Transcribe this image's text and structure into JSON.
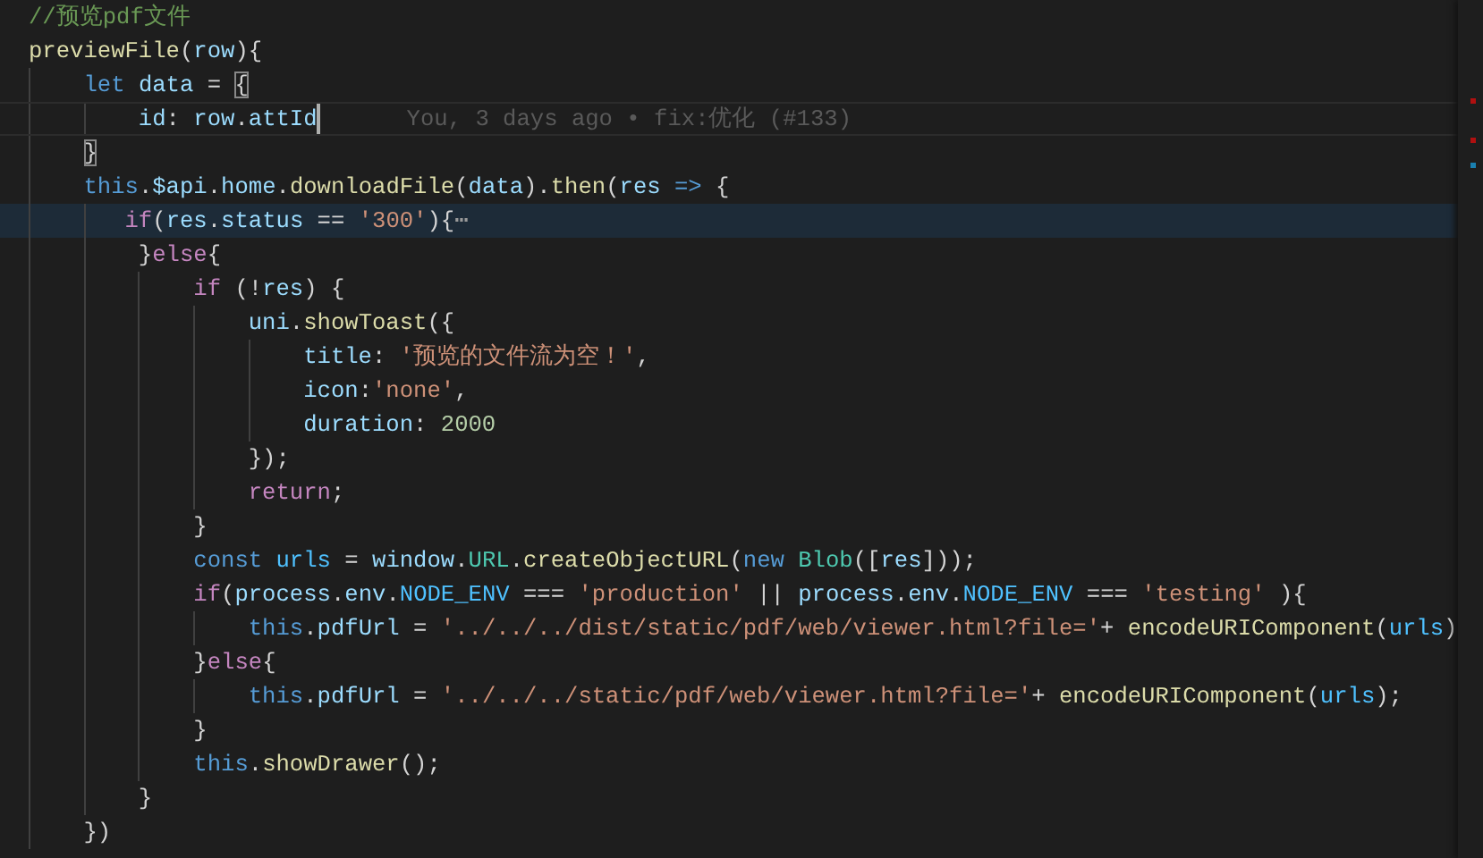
{
  "lines": [
    {
      "tokens": [
        {
          "text": "//预览pdf文件",
          "kind": "comment"
        }
      ]
    },
    {
      "tokens": [
        {
          "text": "previewFile",
          "kind": "function"
        },
        {
          "text": "(",
          "kind": "punct"
        },
        {
          "text": "row",
          "kind": "variable"
        },
        {
          "text": "){",
          "kind": "punct"
        }
      ]
    },
    {
      "tokens": [
        {
          "text": "    let",
          "kind": "keyword"
        },
        {
          "text": " data",
          "kind": "variable"
        },
        {
          "text": " = ",
          "kind": "punct"
        },
        {
          "text": "{",
          "kind": "bracket"
        }
      ]
    },
    {
      "current": true,
      "blame": "You, 3 days ago • fix:优化 (#133)",
      "tokens": [
        {
          "text": "        id",
          "kind": "variable"
        },
        {
          "text": ": ",
          "kind": "punct"
        },
        {
          "text": "row",
          "kind": "variable"
        },
        {
          "text": ".",
          "kind": "punct"
        },
        {
          "text": "attId",
          "kind": "variable"
        }
      ]
    },
    {
      "tokens": [
        {
          "text": "    }",
          "kind": "bracket"
        }
      ]
    },
    {
      "tokens": [
        {
          "text": "    this",
          "kind": "keyword"
        },
        {
          "text": ".",
          "kind": "punct"
        },
        {
          "text": "$api",
          "kind": "variable"
        },
        {
          "text": ".",
          "kind": "punct"
        },
        {
          "text": "home",
          "kind": "variable"
        },
        {
          "text": ".",
          "kind": "punct"
        },
        {
          "text": "downloadFile",
          "kind": "function"
        },
        {
          "text": "(",
          "kind": "punct"
        },
        {
          "text": "data",
          "kind": "variable"
        },
        {
          "text": ").",
          "kind": "punct"
        },
        {
          "text": "then",
          "kind": "function"
        },
        {
          "text": "(",
          "kind": "punct"
        },
        {
          "text": "res",
          "kind": "variable"
        },
        {
          "text": " =>",
          "kind": "keyword"
        },
        {
          "text": " {",
          "kind": "punct"
        }
      ]
    },
    {
      "highlighted": true,
      "tokens": [
        {
          "text": "       if",
          "kind": "control"
        },
        {
          "text": "(",
          "kind": "punct"
        },
        {
          "text": "res",
          "kind": "variable"
        },
        {
          "text": ".",
          "kind": "punct"
        },
        {
          "text": "status",
          "kind": "variable"
        },
        {
          "text": " == ",
          "kind": "punct"
        },
        {
          "text": "'300'",
          "kind": "string"
        },
        {
          "text": "){",
          "kind": "punct"
        },
        {
          "text": "⋯",
          "kind": "fold"
        }
      ]
    },
    {
      "tokens": [
        {
          "text": "        }",
          "kind": "punct"
        },
        {
          "text": "else",
          "kind": "control"
        },
        {
          "text": "{",
          "kind": "punct"
        }
      ]
    },
    {
      "tokens": [
        {
          "text": "            if",
          "kind": "control"
        },
        {
          "text": " (!",
          "kind": "punct"
        },
        {
          "text": "res",
          "kind": "variable"
        },
        {
          "text": ") {",
          "kind": "punct"
        }
      ]
    },
    {
      "tokens": [
        {
          "text": "                uni",
          "kind": "variable"
        },
        {
          "text": ".",
          "kind": "punct"
        },
        {
          "text": "showToast",
          "kind": "function"
        },
        {
          "text": "({",
          "kind": "punct"
        }
      ]
    },
    {
      "tokens": [
        {
          "text": "                    title",
          "kind": "variable"
        },
        {
          "text": ": ",
          "kind": "punct"
        },
        {
          "text": "'预览的文件流为空！'",
          "kind": "string"
        },
        {
          "text": ",",
          "kind": "punct"
        }
      ]
    },
    {
      "tokens": [
        {
          "text": "                    icon",
          "kind": "variable"
        },
        {
          "text": ":",
          "kind": "punct"
        },
        {
          "text": "'none'",
          "kind": "string"
        },
        {
          "text": ",",
          "kind": "punct"
        }
      ]
    },
    {
      "tokens": [
        {
          "text": "                    duration",
          "kind": "variable"
        },
        {
          "text": ": ",
          "kind": "punct"
        },
        {
          "text": "2000",
          "kind": "number"
        }
      ]
    },
    {
      "tokens": [
        {
          "text": "                });",
          "kind": "punct"
        }
      ]
    },
    {
      "tokens": [
        {
          "text": "                return",
          "kind": "control"
        },
        {
          "text": ";",
          "kind": "punct"
        }
      ]
    },
    {
      "tokens": [
        {
          "text": "            }",
          "kind": "punct"
        }
      ]
    },
    {
      "tokens": [
        {
          "text": "            const",
          "kind": "keyword"
        },
        {
          "text": " urls",
          "kind": "constant"
        },
        {
          "text": " = ",
          "kind": "punct"
        },
        {
          "text": "window",
          "kind": "variable"
        },
        {
          "text": ".",
          "kind": "punct"
        },
        {
          "text": "URL",
          "kind": "class"
        },
        {
          "text": ".",
          "kind": "punct"
        },
        {
          "text": "createObjectURL",
          "kind": "function"
        },
        {
          "text": "(",
          "kind": "punct"
        },
        {
          "text": "new",
          "kind": "keyword"
        },
        {
          "text": " Blob",
          "kind": "class"
        },
        {
          "text": "([",
          "kind": "punct"
        },
        {
          "text": "res",
          "kind": "variable"
        },
        {
          "text": "]));",
          "kind": "punct"
        }
      ]
    },
    {
      "tokens": [
        {
          "text": "            if",
          "kind": "control"
        },
        {
          "text": "(",
          "kind": "punct"
        },
        {
          "text": "process",
          "kind": "variable"
        },
        {
          "text": ".",
          "kind": "punct"
        },
        {
          "text": "env",
          "kind": "variable"
        },
        {
          "text": ".",
          "kind": "punct"
        },
        {
          "text": "NODE_ENV",
          "kind": "constant"
        },
        {
          "text": " === ",
          "kind": "punct"
        },
        {
          "text": "'production'",
          "kind": "string"
        },
        {
          "text": " || ",
          "kind": "punct"
        },
        {
          "text": "process",
          "kind": "variable"
        },
        {
          "text": ".",
          "kind": "punct"
        },
        {
          "text": "env",
          "kind": "variable"
        },
        {
          "text": ".",
          "kind": "punct"
        },
        {
          "text": "NODE_ENV",
          "kind": "constant"
        },
        {
          "text": " === ",
          "kind": "punct"
        },
        {
          "text": "'testing'",
          "kind": "string"
        },
        {
          "text": " ){",
          "kind": "punct"
        }
      ]
    },
    {
      "tokens": [
        {
          "text": "                this",
          "kind": "keyword"
        },
        {
          "text": ".",
          "kind": "punct"
        },
        {
          "text": "pdfUrl",
          "kind": "variable"
        },
        {
          "text": " = ",
          "kind": "punct"
        },
        {
          "text": "'../../../dist/static/pdf/web/viewer.html?file='",
          "kind": "string"
        },
        {
          "text": "+ ",
          "kind": "punct"
        },
        {
          "text": "encodeURIComponent",
          "kind": "function"
        },
        {
          "text": "(",
          "kind": "punct"
        },
        {
          "text": "urls",
          "kind": "constant"
        },
        {
          "text": ")",
          "kind": "punct"
        }
      ]
    },
    {
      "tokens": [
        {
          "text": "            }",
          "kind": "punct"
        },
        {
          "text": "else",
          "kind": "control"
        },
        {
          "text": "{",
          "kind": "punct"
        }
      ]
    },
    {
      "tokens": [
        {
          "text": "                this",
          "kind": "keyword"
        },
        {
          "text": ".",
          "kind": "punct"
        },
        {
          "text": "pdfUrl",
          "kind": "variable"
        },
        {
          "text": " = ",
          "kind": "punct"
        },
        {
          "text": "'../../../static/pdf/web/viewer.html?file='",
          "kind": "string"
        },
        {
          "text": "+ ",
          "kind": "punct"
        },
        {
          "text": "encodeURIComponent",
          "kind": "function"
        },
        {
          "text": "(",
          "kind": "punct"
        },
        {
          "text": "urls",
          "kind": "constant"
        },
        {
          "text": ");",
          "kind": "punct"
        }
      ]
    },
    {
      "tokens": [
        {
          "text": "            }",
          "kind": "punct"
        }
      ]
    },
    {
      "tokens": [
        {
          "text": "            this",
          "kind": "keyword"
        },
        {
          "text": ".",
          "kind": "punct"
        },
        {
          "text": "showDrawer",
          "kind": "function"
        },
        {
          "text": "();",
          "kind": "punct"
        }
      ]
    },
    {
      "tokens": [
        {
          "text": "        }",
          "kind": "punct"
        }
      ]
    },
    {
      "tokens": [
        {
          "text": "    })",
          "kind": "punct"
        }
      ]
    }
  ]
}
